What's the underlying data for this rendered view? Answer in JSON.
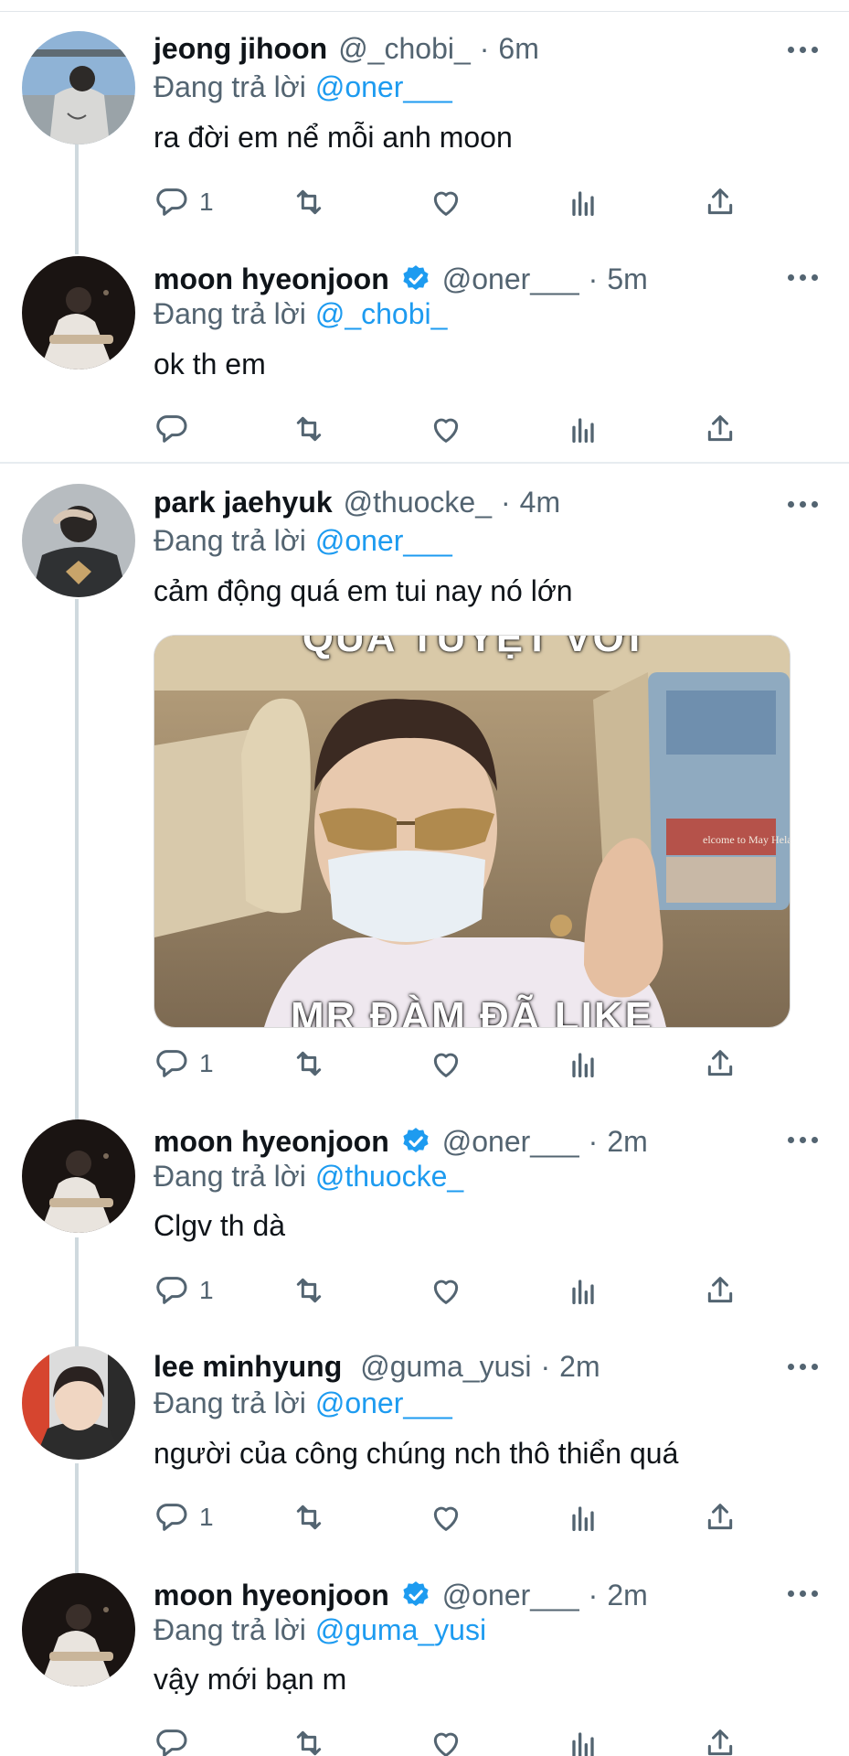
{
  "colors": {
    "name": "#0f1419",
    "secondary": "#536471",
    "accent": "#1d9bf0",
    "thread_line": "#cfd9de"
  },
  "reply_prefix": "Đang trả lời",
  "tweets": [
    {
      "name": "jeong jihoon",
      "handle": "@_chobi_",
      "time": "6m",
      "verified": false,
      "reply_to": "@oner___",
      "text": "ra đời em nể mỗi anh moon",
      "reply_count": "1"
    },
    {
      "name": "moon hyeonjoon",
      "handle": "@oner___",
      "time": "5m",
      "verified": true,
      "reply_to": "@_chobi_",
      "text": "ok th em",
      "reply_count": ""
    },
    {
      "name": "park jaehyuk",
      "handle": "@thuocke_",
      "time": "4m",
      "verified": false,
      "reply_to": "@oner___",
      "text": "cảm động quá em tui nay nó lớn",
      "reply_count": "1",
      "media": {
        "caption_top": "QUÁ TUYỆT VỜI",
        "caption_bottom": "MR ĐÀM ĐÃ LIKE",
        "sign_text": "elcome to May Hela"
      }
    },
    {
      "name": "moon hyeonjoon",
      "handle": "@oner___",
      "time": "2m",
      "verified": true,
      "reply_to": "@thuocke_",
      "text": "Clgv th dà",
      "reply_count": "1"
    },
    {
      "name": "lee minhyung",
      "handle": "@guma_yusi",
      "time": "2m",
      "verified": false,
      "reply_to": "@oner___",
      "text": "người của công chúng nch thô thiển quá",
      "reply_count": "1"
    },
    {
      "name": "moon hyeonjoon",
      "handle": "@oner___",
      "time": "2m",
      "verified": true,
      "reply_to": "@guma_yusi",
      "text": "vậy mới bạn m",
      "reply_count": ""
    }
  ],
  "icons": {
    "reply": "reply-icon",
    "retweet": "retweet-icon",
    "like": "like-icon",
    "views": "views-icon",
    "share": "share-icon",
    "more": "more-icon",
    "verified": "verified-badge-icon"
  }
}
